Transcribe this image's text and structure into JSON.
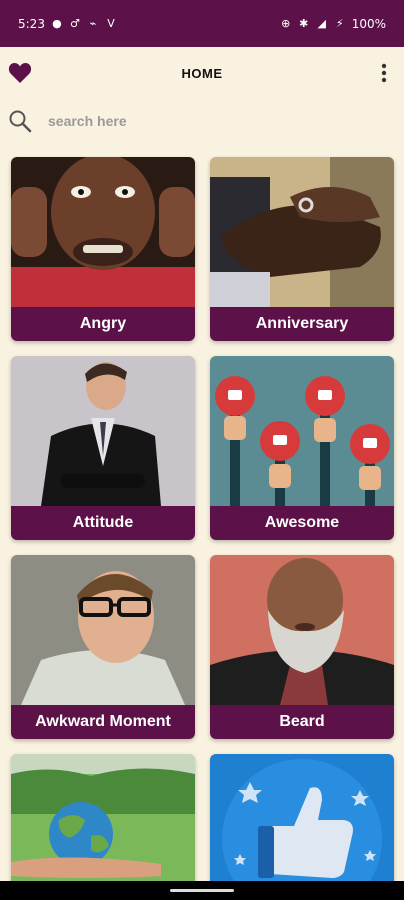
{
  "status": {
    "time": "5:23",
    "battery": "100%"
  },
  "header": {
    "title": "HOME"
  },
  "search": {
    "placeholder": "search here"
  },
  "categories": [
    {
      "label": "Angry",
      "image": "angry-man-photo"
    },
    {
      "label": "Anniversary",
      "image": "ring-hands-photo"
    },
    {
      "label": "Attitude",
      "image": "businessman-photo"
    },
    {
      "label": "Awesome",
      "image": "thumbs-up-signs-illustration"
    },
    {
      "label": "Awkward Moment",
      "image": "man-glasses-photo"
    },
    {
      "label": "Beard",
      "image": "bearded-man-photo"
    },
    {
      "label": "",
      "image": "globe-in-hand-photo"
    },
    {
      "label": "",
      "image": "thumbs-up-icon-illustration"
    }
  ],
  "colors": {
    "brand": "#5c1248",
    "background": "#faf2e0"
  }
}
